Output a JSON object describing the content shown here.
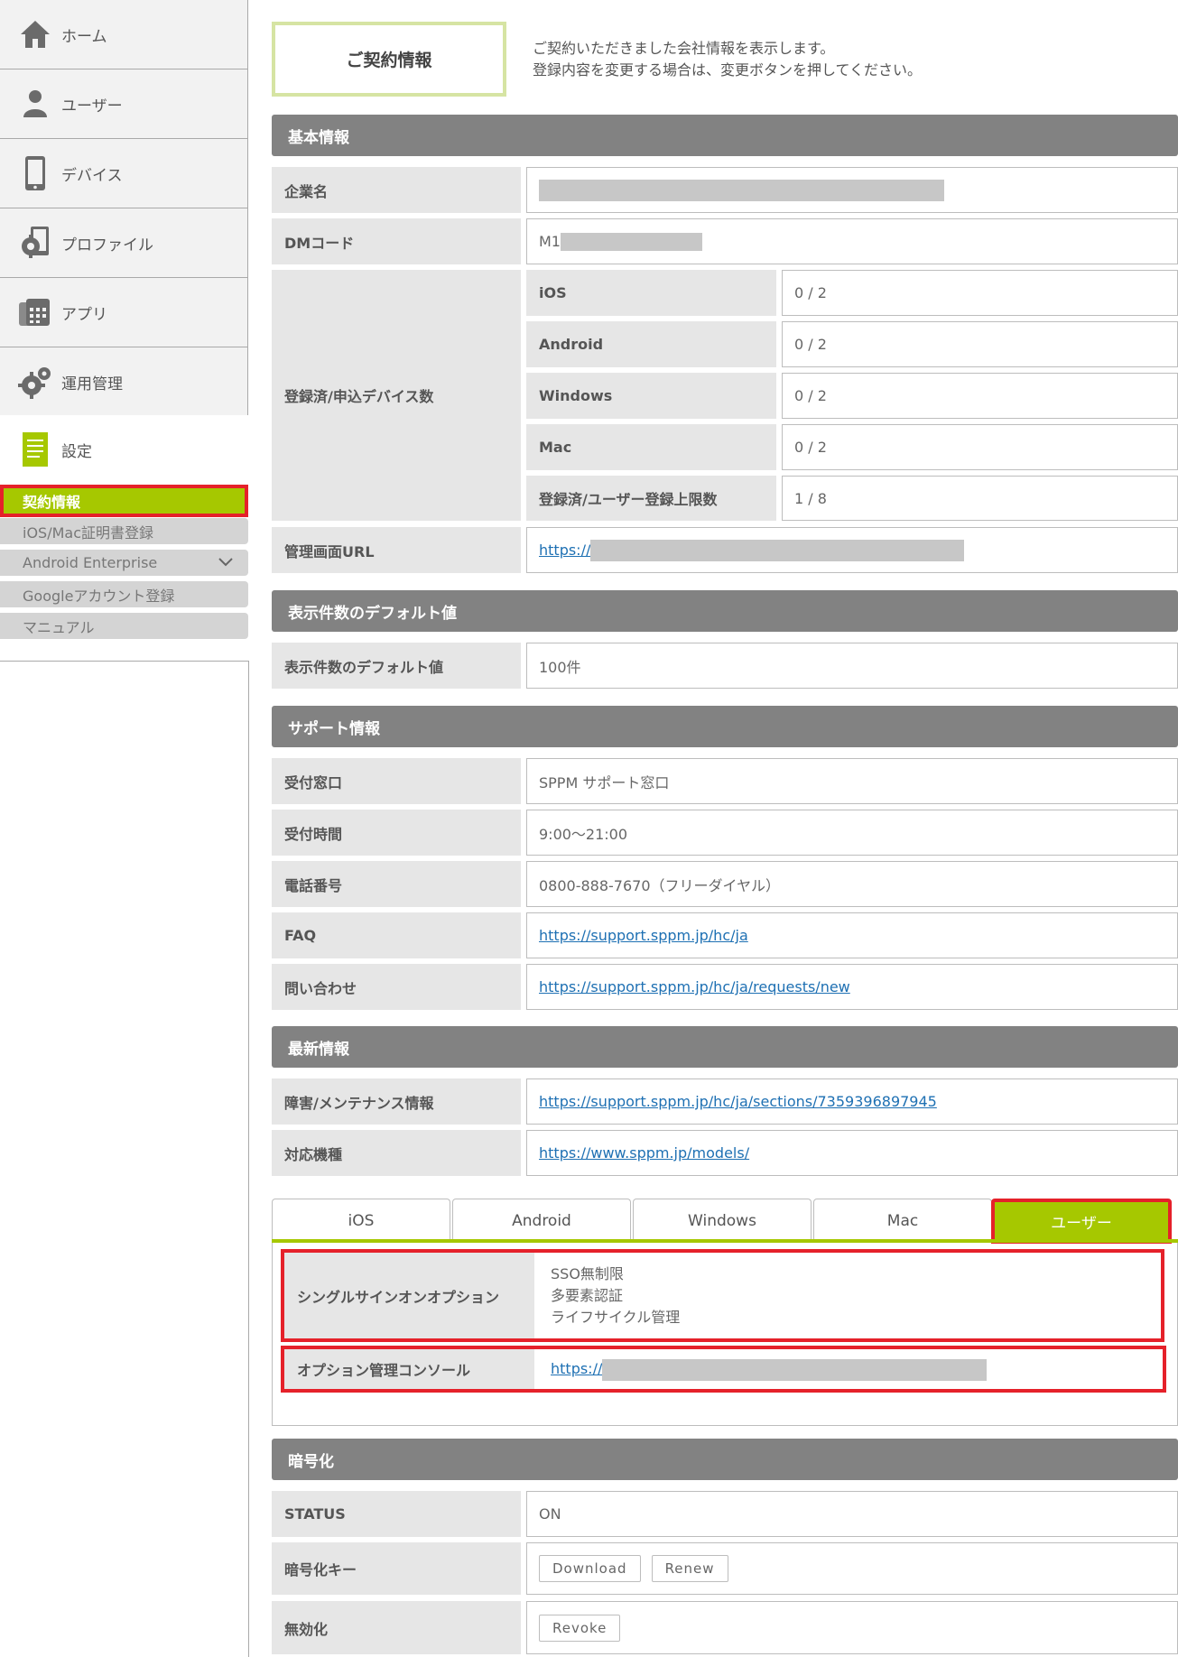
{
  "sidebar": {
    "items": [
      {
        "label": "ホーム",
        "icon": "home-icon"
      },
      {
        "label": "ユーザー",
        "icon": "user-icon"
      },
      {
        "label": "デバイス",
        "icon": "smartphone-icon"
      },
      {
        "label": "プロファイル",
        "icon": "profile-gear-icon"
      },
      {
        "label": "アプリ",
        "icon": "app-grid-icon"
      },
      {
        "label": "運用管理",
        "icon": "gears-icon"
      }
    ],
    "settings": {
      "label": "設定",
      "icon": "document-icon"
    },
    "subitems": [
      {
        "label": "契約情報",
        "active": true
      },
      {
        "label": "iOS/Mac証明書登録"
      },
      {
        "label": "Android Enterprise"
      },
      {
        "label": "Googleアカウント登録"
      },
      {
        "label": "マニュアル"
      }
    ]
  },
  "header": {
    "title": "ご契約情報",
    "intro_line1": "ご契約いただきました会社情報を表示します。",
    "intro_line2": "登録内容を変更する場合は、変更ボタンを押してください。"
  },
  "basic": {
    "heading": "基本情報",
    "company_label": "企業名",
    "dm_label": "DMコード",
    "dm_prefix": "M1",
    "devices_label": "登録済/申込デバイス数",
    "devices": [
      {
        "label": "iOS",
        "value": "0 / 2"
      },
      {
        "label": "Android",
        "value": "0 / 2"
      },
      {
        "label": "Windows",
        "value": "0 / 2"
      },
      {
        "label": "Mac",
        "value": "0 / 2"
      },
      {
        "label": "登録済/ユーザー登録上限数",
        "value": "1 / 8"
      }
    ],
    "url_label": "管理画面URL",
    "url_prefix": "https://"
  },
  "display": {
    "heading": "表示件数のデフォルト値",
    "label": "表示件数のデフォルト値",
    "value": "100件"
  },
  "support": {
    "heading": "サポート情報",
    "rows": [
      {
        "label": "受付窓口",
        "value": "SPPM サポート窓口"
      },
      {
        "label": "受付時間",
        "value": "9:00～21:00"
      },
      {
        "label": "電話番号",
        "value": "0800-888-7670（フリーダイヤル）"
      },
      {
        "label": "FAQ",
        "value": "https://support.sppm.jp/hc/ja"
      },
      {
        "label": "問い合わせ",
        "value": "https://support.sppm.jp/hc/ja/requests/new"
      }
    ]
  },
  "news": {
    "heading": "最新情報",
    "rows": [
      {
        "label": "障害/メンテナンス情報",
        "value": "https://support.sppm.jp/hc/ja/sections/7359396897945"
      },
      {
        "label": "対応機種",
        "value": "https://www.sppm.jp/models/"
      }
    ]
  },
  "tabs": {
    "items": [
      "iOS",
      "Android",
      "Windows",
      "Mac",
      "ユーザー"
    ],
    "active_index": 4
  },
  "user_panel": {
    "sso_label": "シングルサインオンオプション",
    "sso_values": [
      "SSO無制限",
      "多要素認証",
      "ライフサイクル管理"
    ],
    "console_label": "オプション管理コンソール",
    "console_prefix": "https://"
  },
  "encryption": {
    "heading": "暗号化",
    "status_label": "STATUS",
    "status_value": "ON",
    "key_label": "暗号化キー",
    "download_label": "Download",
    "renew_label": "Renew",
    "disable_label": "無効化",
    "revoke_label": "Revoke"
  },
  "colors": {
    "accent": "#a6c800",
    "highlight": "#e5212a",
    "section_header": "#828282",
    "link": "#1e70b3"
  }
}
